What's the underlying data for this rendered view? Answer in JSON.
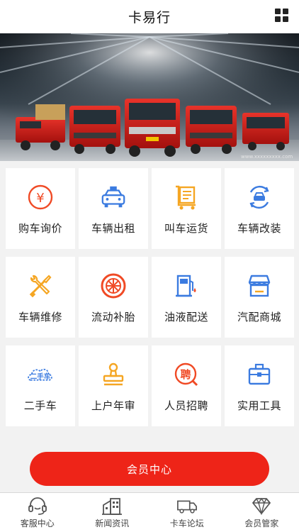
{
  "header": {
    "title": "卡易行",
    "menu_icon": "grid-icon"
  },
  "banner": {
    "description_icon": "trucks-photo",
    "watermark": "www.xxxxxxxxx.com"
  },
  "services": [
    {
      "label": "购车询价",
      "icon": "yuan-coin-icon",
      "color": "#f04a25"
    },
    {
      "label": "车辆出租",
      "icon": "taxi-icon",
      "color": "#3b7be0"
    },
    {
      "label": "叫车运货",
      "icon": "cargo-cart-icon",
      "color": "#f5a623"
    },
    {
      "label": "车辆改装",
      "icon": "car-refit-icon",
      "color": "#3b7be0"
    },
    {
      "label": "车辆维修",
      "icon": "wrench-screwdriver-icon",
      "color": "#f5a623"
    },
    {
      "label": "流动补胎",
      "icon": "tire-icon",
      "color": "#f04a25"
    },
    {
      "label": "油液配送",
      "icon": "fuel-pump-icon",
      "color": "#3b7be0"
    },
    {
      "label": "汽配商城",
      "icon": "shop-icon",
      "color": "#3b7be0"
    },
    {
      "label": "二手车",
      "icon": "used-car-cloud-icon",
      "color": "#3b7be0"
    },
    {
      "label": "上户年审",
      "icon": "stamp-icon",
      "color": "#f5a623"
    },
    {
      "label": "人员招聘",
      "icon": "recruit-icon",
      "color": "#f04a25"
    },
    {
      "label": "实用工具",
      "icon": "toolbox-icon",
      "color": "#3b7be0"
    }
  ],
  "member_button": {
    "label": "会员中心",
    "color": "#ee2418"
  },
  "tabbar": [
    {
      "label": "客服中心",
      "icon": "headset-icon"
    },
    {
      "label": "新闻资讯",
      "icon": "buildings-icon"
    },
    {
      "label": "卡车论坛",
      "icon": "truck-icon"
    },
    {
      "label": "会员管家",
      "icon": "diamond-icon"
    }
  ]
}
